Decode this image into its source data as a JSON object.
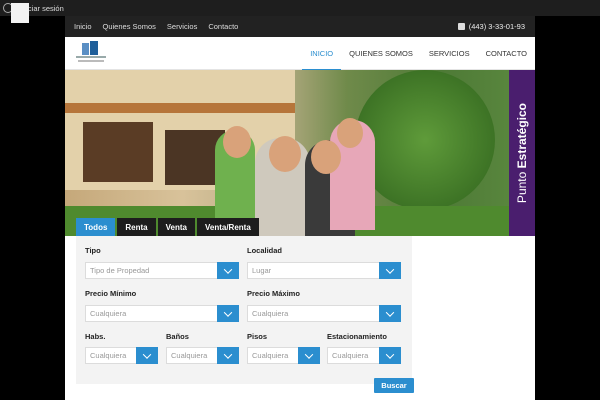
{
  "adminbar": {
    "login": "Iniciar sesión"
  },
  "topbar": {
    "links": [
      "Inicio",
      "Quienes Somos",
      "Servicios",
      "Contacto"
    ],
    "phone": "(443) 3-33-01-93"
  },
  "nav": {
    "items": [
      "INICIO",
      "QUIENES SOMOS",
      "SERVICIOS",
      "CONTACTO"
    ],
    "active": "INICIO"
  },
  "hero": {
    "brand_light": "Punto ",
    "brand_bold": "Estratégico"
  },
  "tabs": [
    "Todos",
    "Renta",
    "Venta",
    "Venta/Renta"
  ],
  "form": {
    "tipo_label": "Tipo",
    "tipo_value": "Tipo de Propedad",
    "localidad_label": "Localidad",
    "localidad_value": "Lugar",
    "precio_min_label": "Precio Mínimo",
    "precio_min_value": "Cualquiera",
    "precio_max_label": "Precio Máximo",
    "precio_max_value": "Cualquiera",
    "habs_label": "Habs.",
    "habs_value": "Cualquiera",
    "banos_label": "Baños",
    "banos_value": "Cualquiera",
    "pisos_label": "Pisos",
    "pisos_value": "Cualquiera",
    "estac_label": "Estacionamiento",
    "estac_value": "Cualquiera",
    "submit": "Buscar"
  },
  "colors": {
    "accent": "#2b8ecf",
    "brand_band": "#4a1e6e",
    "topbar": "#222222"
  },
  "icons": {
    "wp": "wordpress-icon",
    "search": "search-icon",
    "phone": "phone-icon"
  }
}
